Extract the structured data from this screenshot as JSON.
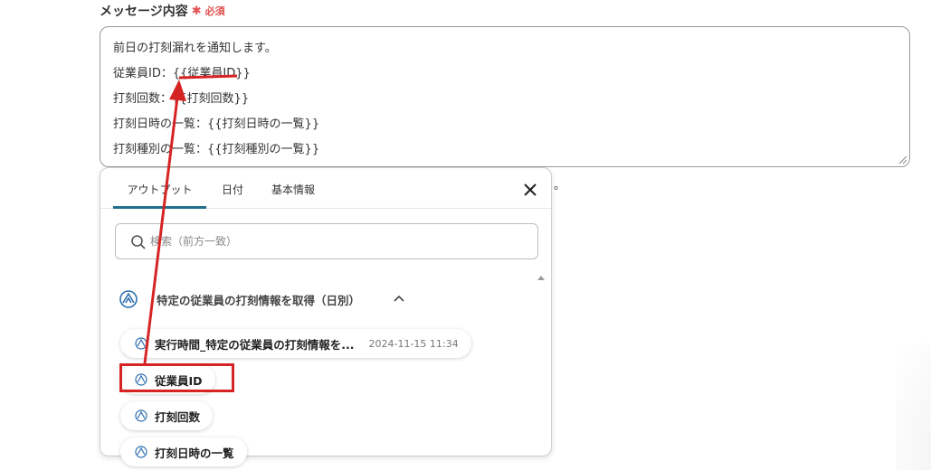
{
  "field": {
    "label": "メッセージ内容",
    "required_mark": "✱",
    "required_text": "必須",
    "lines": [
      "前日の打刻漏れを通知します。",
      "従業員ID：{{従業員ID}}",
      "打刻回数：{{打刻回数}}",
      "打刻日時の一覧：{{打刻日時の一覧}}",
      "打刻種別の一覧：{{打刻種別の一覧}}"
    ],
    "trailing_text": "。"
  },
  "panel": {
    "tabs": [
      "アウトプット",
      "日付",
      "基本情報"
    ],
    "active_tab": "アウトプット",
    "search_placeholder": "検索（前方一致）",
    "search_value": "",
    "section_title": "特定の従業員の打刻情報を取得（日別）",
    "items": [
      {
        "label": "実行時間_特定の従業員の打刻情報を...",
        "time": "2024-11-15 11:34"
      },
      {
        "label": "従業員ID",
        "time": ""
      },
      {
        "label": "打刻回数",
        "time": ""
      },
      {
        "label": "打刻日時の一覧",
        "time": ""
      }
    ]
  },
  "colors": {
    "accent_tab": "#1f6f8b",
    "required": "#e05050",
    "annotation_red": "#d62424",
    "icon_blue": "#2f6fae"
  },
  "icons": {
    "close": "close-icon",
    "search": "search-icon",
    "section": "app-logo-icon",
    "collapse": "chevron-up-icon",
    "item": "app-logo-icon"
  }
}
